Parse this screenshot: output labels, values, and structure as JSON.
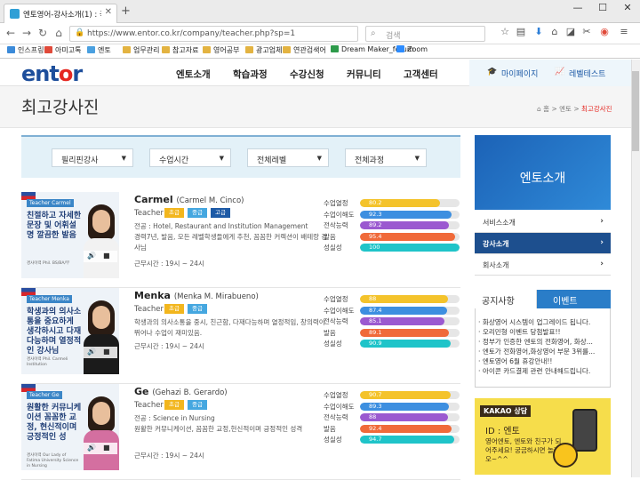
{
  "browser": {
    "tab_title": "엔토영어-강사소개(1) : 국...",
    "url": "https://www.entor.co.kr/company/teacher.php?sp=1",
    "search_placeholder": "검색",
    "bookmarks": [
      {
        "label": "인스프링",
        "color": "#3b8ad9"
      },
      {
        "label": "아미고톡",
        "color": "#e04a3a"
      },
      {
        "label": "엔토",
        "color": "#4aa0e0"
      },
      {
        "label": "업무관리",
        "color": "#e3b341"
      },
      {
        "label": "참고자료",
        "color": "#e3b341"
      },
      {
        "label": "영어공부",
        "color": "#e3b341"
      },
      {
        "label": "광고업체",
        "color": "#e3b341"
      },
      {
        "label": "연관검색어",
        "color": "#e3b341"
      },
      {
        "label": "Dream Maker_forum",
        "color": "#2d9a4a"
      },
      {
        "label": "Zoom",
        "color": "#2d8cff"
      }
    ]
  },
  "site": {
    "logo_a": "ent",
    "logo_o": "o",
    "logo_b": "r",
    "nav": [
      "엔토소개",
      "학습과정",
      "수강신청",
      "커뮤니티",
      "고객센터"
    ],
    "mypage": "마이페이지",
    "leveltest": "레벨테스트"
  },
  "page": {
    "title": "최고강사진",
    "crumb_home": "홈",
    "crumb_sep": ">",
    "crumb_1": "엔토",
    "crumb_cur": "최고강사진"
  },
  "filters": [
    "필리핀강사",
    "수업시간",
    "전체레벨",
    "전체과정"
  ],
  "score_labels": [
    "수업열정",
    "수업이해도",
    "전삭능력",
    "발음",
    "성실성"
  ],
  "teachers": [
    {
      "name": "Carmel",
      "full": "(Carmel M. Cinco)",
      "tag": "Teacher Carmel",
      "slogan": "친절하고 자세한 문장 및 어휘설명 깔끔한 발음",
      "photo_sub": "경사이력 Phil. BS/BA/부",
      "role": "Teacher",
      "badges": [
        {
          "label": "초급",
          "color": "#f2b61e"
        },
        {
          "label": "중급",
          "color": "#45a7e0"
        },
        {
          "label": "고급",
          "color": "#1d5aa6"
        }
      ],
      "desc1": "전공 : Hotel, Restaurant and Institution Management",
      "desc2": "경력7년, 발음, 모든 레벨학생들에게 추천, 꼼꼼한 커렉션이 배테랑 강사님",
      "hours": "근무시간 : 19시 ~ 24시",
      "scores": [
        80.2,
        92.3,
        89.2,
        95.4,
        100
      ]
    },
    {
      "name": "Menka",
      "full": "(Menka M. Mirabueno)",
      "tag": "Teacher Menka",
      "slogan": "학생과의 의사소통을 중요하게 생각하시고 다재다능하며 열정적인 강사님",
      "photo_sub": "경사이력 Phil. Carmeli Institution",
      "role": "Teacher",
      "badges": [
        {
          "label": "초급",
          "color": "#f2b61e"
        },
        {
          "label": "중급",
          "color": "#45a7e0"
        }
      ],
      "desc1": "학생과의 의사소통을 중시, 친근함, 다재다능하며 열정적임, 창의력이 뛰어나 수업이 재미있음.",
      "desc2": "",
      "hours": "근무시간 : 19시 ~ 24시",
      "scores": [
        88,
        87.4,
        85.1,
        89.1,
        90.9
      ]
    },
    {
      "name": "Ge",
      "full": "(Gehazi B. Gerardo)",
      "tag": "Teacher Ge",
      "slogan": "원활한 커뮤니케이션 꼼꼼한 교정, 현신적이며 긍정적인 성",
      "photo_sub": "경사이력 Our Lady of Fatima University Science in Nursing",
      "role": "Teacher",
      "badges": [
        {
          "label": "초급",
          "color": "#f2b61e"
        },
        {
          "label": "중급",
          "color": "#45a7e0"
        }
      ],
      "desc1": "전공 : Science in Nursing",
      "desc2": "원활한 커뮤니케이션, 꼼꼼한 교정,헌신적이며 긍정적인 성격",
      "hours": "근무시간 : 19시 ~ 24시",
      "scores": [
        90.7,
        89.3,
        88,
        92.4,
        94.7
      ]
    }
  ],
  "score_colors": [
    "#f4c32b",
    "#3d8fe0",
    "#9b59d0",
    "#f06a3a",
    "#1fc4c9"
  ],
  "sidebar": {
    "about": "엔토소개",
    "menu": [
      {
        "label": "서비스소개",
        "active": false
      },
      {
        "label": "강사소개",
        "active": true
      },
      {
        "label": "회사소개",
        "active": false
      }
    ],
    "notice_tab": "공지사항",
    "event_tab": "이벤트",
    "notices": [
      "· 화상영어 시스템이 업그레이드 됩니다.",
      "· 오리민형 이벤트 당첨발표!!",
      "· 정부가 인증한 엔토의 전화영어, 화상...",
      "· 엔토가 전화영어,화상영어 부문 3위를...",
      "· 엔토영어 6월 휴강안내!!",
      "· 아이콘 카드결제 관련 안내해드립니다."
    ],
    "kakao_label": "KAKAO",
    "kakao_label2": "상담",
    "kakao_id": "ID : 엔토",
    "kakao_desc": "영어엔토, 엔토와 친구가 되어주세요! 궁금하시면 놀러오~^^"
  }
}
